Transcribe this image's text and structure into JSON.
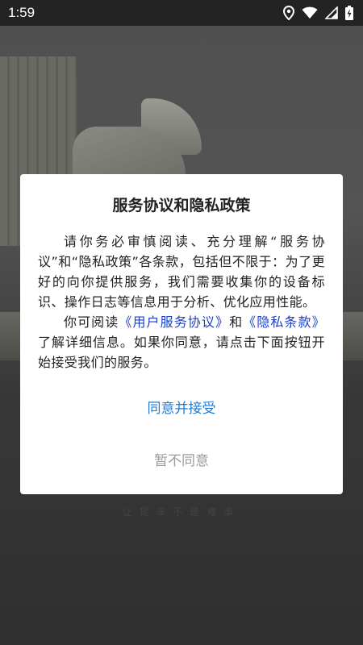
{
  "status_bar": {
    "time": "1:59",
    "icons": [
      "location-icon",
      "wifi-icon",
      "signal-icon",
      "battery-charging-icon"
    ]
  },
  "background": {
    "slogan": "让货车不是难事"
  },
  "dialog": {
    "title": "服务协议和隐私政策",
    "para1": "请你务必审慎阅读、充分理解“服务协议”和“隐私政策”各条款，包括但不限于：为了更好的向你提供服务，我们需要收集你的设备标识、操作日志等信息用于分析、优化应用性能。",
    "para2_prefix": "你可阅读",
    "user_agreement_link": "《用户服务协议》",
    "para2_and": "和",
    "privacy_link": "《隐私条款》",
    "para2_suffix": "了解详细信息。如果你同意，请点击下面按钮开始接受我们的服务。",
    "agree_label": "同意并接受",
    "disagree_label": "暂不同意"
  },
  "colors": {
    "link": "#1a3fc9",
    "agree": "#1f7bd6",
    "disagree": "#9a9a9a"
  }
}
